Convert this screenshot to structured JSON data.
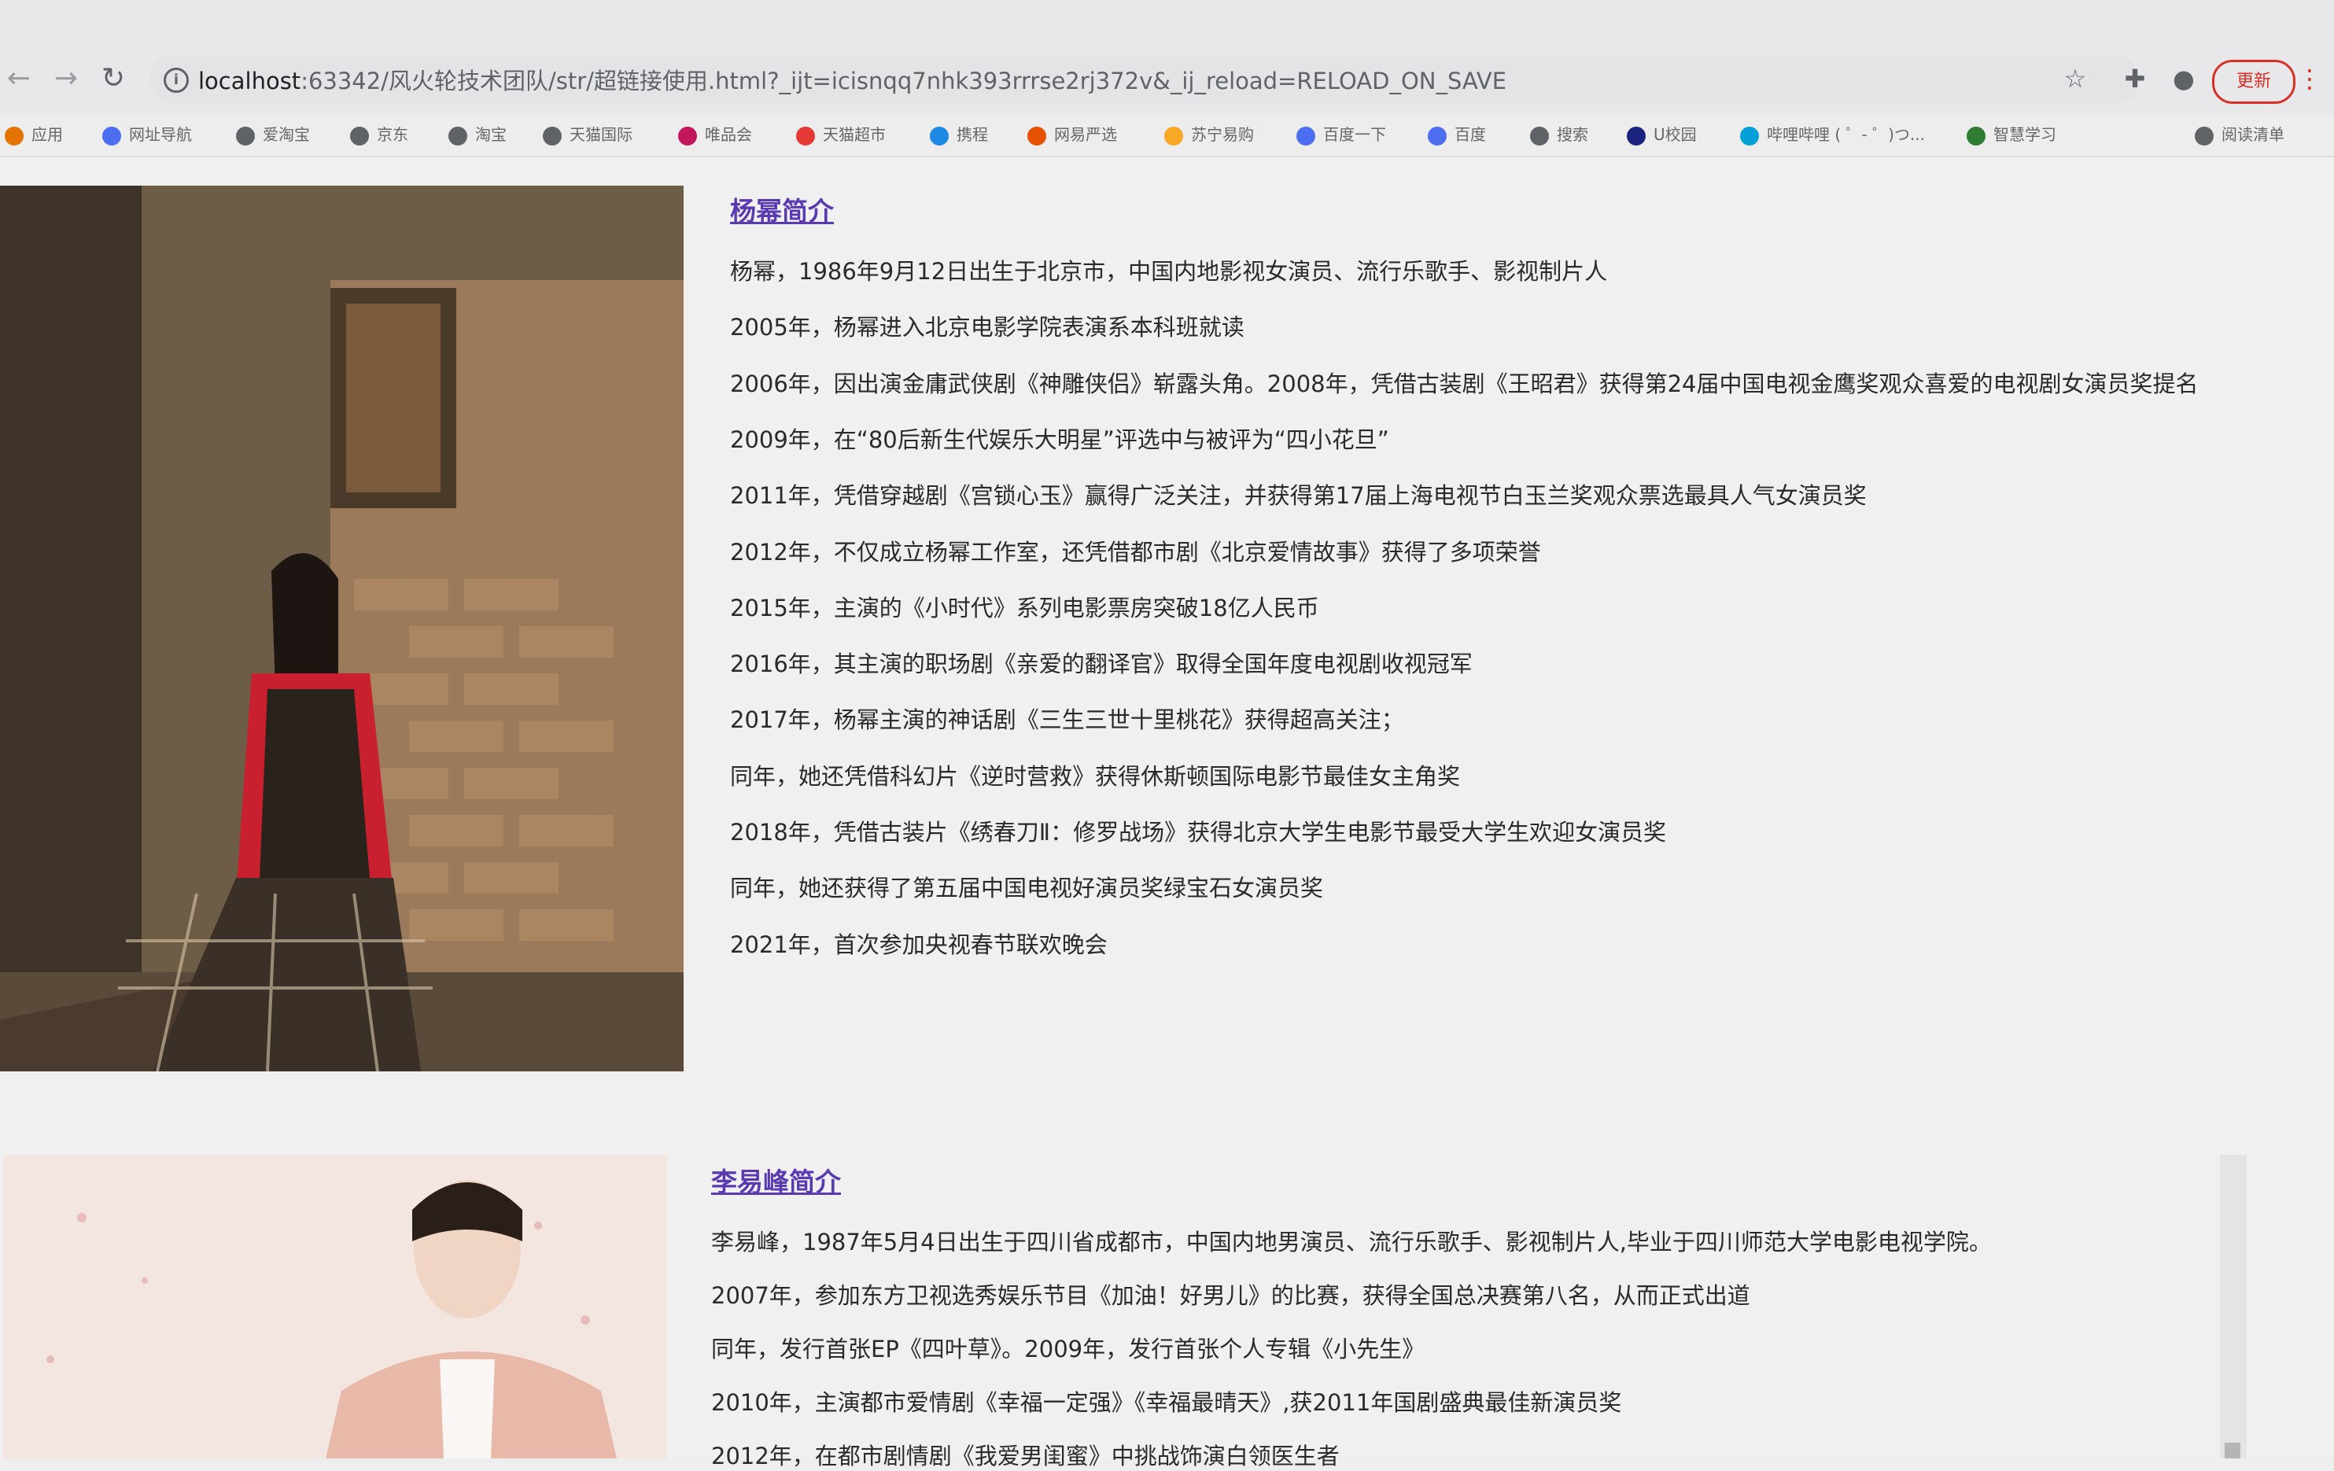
{
  "browser": {
    "url_host": "localhost",
    "url_rest": ":63342/风火轮技术团队/str/超链接使用.html?_ijt=icisnqq7nhk393rrrse2rj372v&_ij_reload=RELOAD_ON_SAVE",
    "update_label": "更新",
    "back_icon": "←",
    "forward_icon": "→",
    "reload_icon": "↻",
    "star_icon": "☆",
    "extensions_icon": "✚",
    "profile_icon": "●",
    "menu_icon": "⋮",
    "bookmarks": [
      {
        "label": "应用",
        "icon": "apps-icon",
        "color": "#e37400"
      },
      {
        "label": "网址导航",
        "icon": "paw-icon",
        "color": "#4e6ef2"
      },
      {
        "label": "爱淘宝",
        "icon": "globe-icon",
        "color": "#5f6368"
      },
      {
        "label": "京东",
        "icon": "globe-icon",
        "color": "#5f6368"
      },
      {
        "label": "淘宝",
        "icon": "globe-icon",
        "color": "#5f6368"
      },
      {
        "label": "天猫国际",
        "icon": "globe-icon",
        "color": "#5f6368"
      },
      {
        "label": "唯品会",
        "icon": "vip-icon",
        "color": "#c2185b"
      },
      {
        "label": "天猫超市",
        "icon": "tmall-icon",
        "color": "#e53935"
      },
      {
        "label": "携程",
        "icon": "ctrip-icon",
        "color": "#1e88e5"
      },
      {
        "label": "网易严选",
        "icon": "yanxuan-icon",
        "color": "#e65100"
      },
      {
        "label": "苏宁易购",
        "icon": "suning-icon",
        "color": "#f9a825"
      },
      {
        "label": "百度一下",
        "icon": "paw-icon",
        "color": "#4e6ef2"
      },
      {
        "label": "百度",
        "icon": "paw-icon",
        "color": "#4e6ef2"
      },
      {
        "label": "搜索",
        "icon": "globe-icon",
        "color": "#5f6368"
      },
      {
        "label": "U校园",
        "icon": "u-icon",
        "color": "#1a237e"
      },
      {
        "label": "哔哩哔哩 ( ゜- ゜)つ...",
        "icon": "bilibili-icon",
        "color": "#00a1d6"
      },
      {
        "label": "智慧学习",
        "icon": "leaf-icon",
        "color": "#2e7d32"
      },
      {
        "label": "阅读清单",
        "icon": "reading-list-icon",
        "color": "#5f6368"
      }
    ]
  },
  "yangmi": {
    "title": "杨幂简介",
    "lines": [
      "杨幂，1986年9月12日出生于北京市，中国内地影视女演员、流行乐歌手、影视制片人",
      "2005年，杨幂进入北京电影学院表演系本科班就读",
      "2006年，因出演金庸武侠剧《神雕侠侣》崭露头角。2008年，凭借古装剧《王昭君》获得第24届中国电视金鹰奖观众喜爱的电视剧女演员奖提名",
      "2009年，在“80后新生代娱乐大明星”评选中与被评为“四小花旦”",
      "2011年，凭借穿越剧《宫锁心玉》赢得广泛关注，并获得第17届上海电视节白玉兰奖观众票选最具人气女演员奖",
      "2012年，不仅成立杨幂工作室，还凭借都市剧《北京爱情故事》获得了多项荣誉",
      "2015年，主演的《小时代》系列电影票房突破18亿人民币",
      "2016年，其主演的职场剧《亲爱的翻译官》取得全国年度电视剧收视冠军",
      "2017年，杨幂主演的神话剧《三生三世十里桃花》获得超高关注；",
      "同年，她还凭借科幻片《逆时营救》获得休斯顿国际电影节最佳女主角奖",
      "2018年，凭借古装片《绣春刀Ⅱ：修罗战场》获得北京大学生电影节最受大学生欢迎女演员奖",
      "同年，她还获得了第五届中国电视好演员奖绿宝石女演员奖",
      "2021年，首次参加央视春节联欢晚会"
    ]
  },
  "liyifeng": {
    "title": "李易峰简介",
    "lines": [
      "李易峰，1987年5月4日出生于四川省成都市，中国内地男演员、流行乐歌手、影视制片人,毕业于四川师范大学电影电视学院。",
      "2007年，参加东方卫视选秀娱乐节目《加油！好男儿》的比赛，获得全国总决赛第八名，从而正式出道",
      "同年，发行首张EP《四叶草》。2009年，发行首张个人专辑《小先生》",
      "2010年，主演都市爱情剧《幸福一定强》《幸福最晴天》,获2011年国剧盛典最佳新演员奖",
      "2012年，在都市剧情剧《我爱男闺蜜》中挑战饰演白领医生者"
    ]
  }
}
